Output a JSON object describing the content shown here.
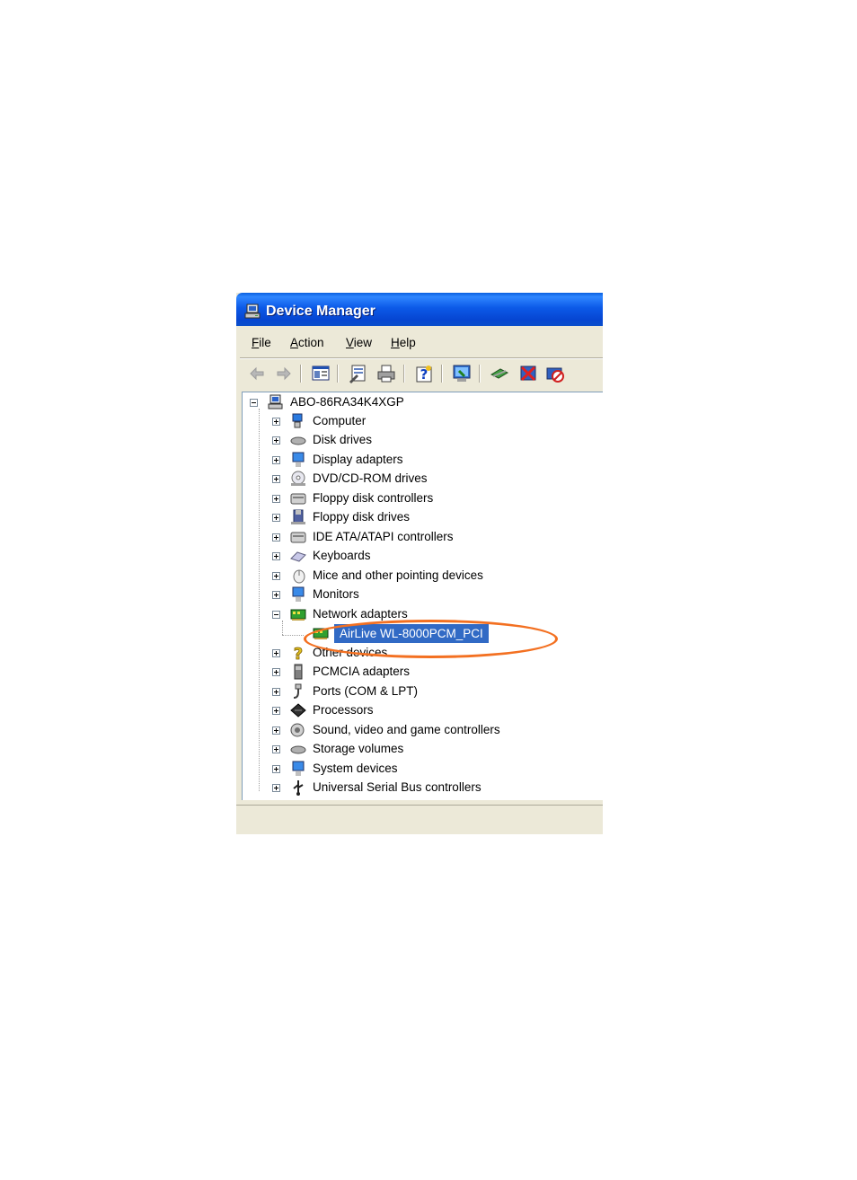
{
  "page": {
    "glyphs": [
      "",
      "",
      "",
      "",
      ""
    ]
  },
  "window": {
    "title": "Device Manager",
    "menu": [
      {
        "label": "File",
        "accel": "F",
        "rest": "ile"
      },
      {
        "label": "Action",
        "accel": "A",
        "rest": "ction"
      },
      {
        "label": "View",
        "accel": "V",
        "rest": "iew"
      },
      {
        "label": "Help",
        "accel": "H",
        "rest": "elp"
      }
    ],
    "toolbar": [
      "back-icon",
      "forward-icon",
      "show-hide-console-tree-icon",
      "properties-icon",
      "print-icon",
      "help-icon",
      "scan-hardware-icon",
      "update-driver-icon",
      "uninstall-icon",
      "disable-icon"
    ]
  },
  "tree": {
    "root": "ABO-86RA34K4XGP",
    "categories": [
      "Computer",
      "Disk drives",
      "Display adapters",
      "DVD/CD-ROM drives",
      "Floppy disk controllers",
      "Floppy disk drives",
      "IDE ATA/ATAPI controllers",
      "Keyboards",
      "Mice and other pointing devices",
      "Monitors",
      "Network adapters",
      "Other devices",
      "PCMCIA adapters",
      "Ports (COM & LPT)",
      "Processors",
      "Sound, video and game controllers",
      "Storage volumes",
      "System devices",
      "Universal Serial Bus controllers"
    ],
    "selected_device": "AirLive WL-8000PCM_PCI"
  },
  "colors": {
    "selection": "#316ac5",
    "annotation": "#f37021",
    "titlebar": "#0a4ecb"
  }
}
